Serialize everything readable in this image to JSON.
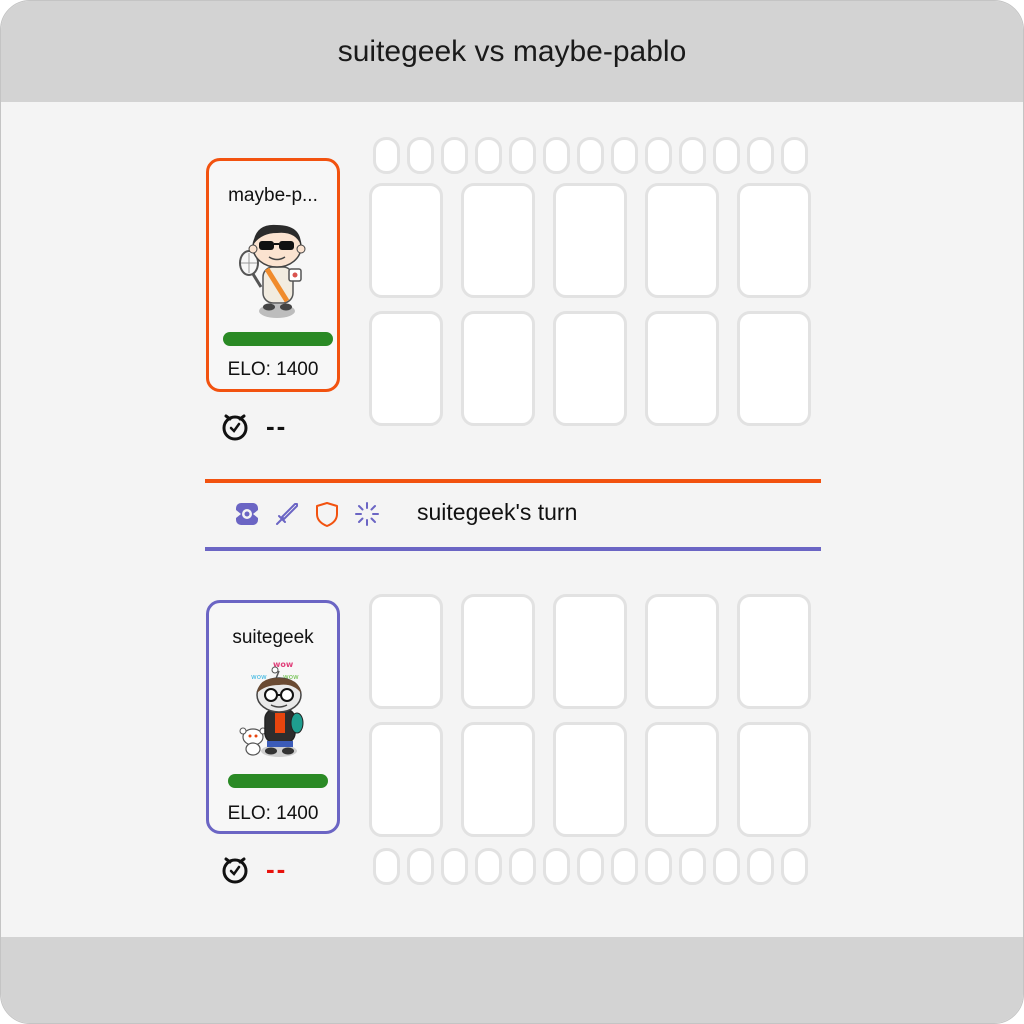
{
  "header": {
    "title": "suitegeek vs maybe-pablo"
  },
  "opponent": {
    "name": "maybe-p...",
    "elo_text": "ELO: 1400",
    "timer_text": "--",
    "health_fraction": 1.0,
    "border_color": "#f2520f",
    "avatar_icon": "reddit-snoo-sunglasses-tennis-avatar"
  },
  "player": {
    "name": "suitegeek",
    "elo_text": "ELO: 1400",
    "timer_text": "--",
    "timer_color": "#e8120c",
    "health_fraction": 1.0,
    "border_color": "#6b65c4",
    "avatar_icon": "reddit-snoo-glasses-wow-avatar"
  },
  "status": {
    "turn_text": "suitegeek's turn",
    "icons": [
      "focus-icon",
      "sword-icon",
      "shield-icon",
      "loading-icon"
    ]
  },
  "board": {
    "opponent_slots": 10,
    "player_slots": 10,
    "pips_per_row": 13
  },
  "colors": {
    "opponent_accent": "#f2520f",
    "player_accent": "#6b65c4",
    "health": "#2a8a25"
  }
}
